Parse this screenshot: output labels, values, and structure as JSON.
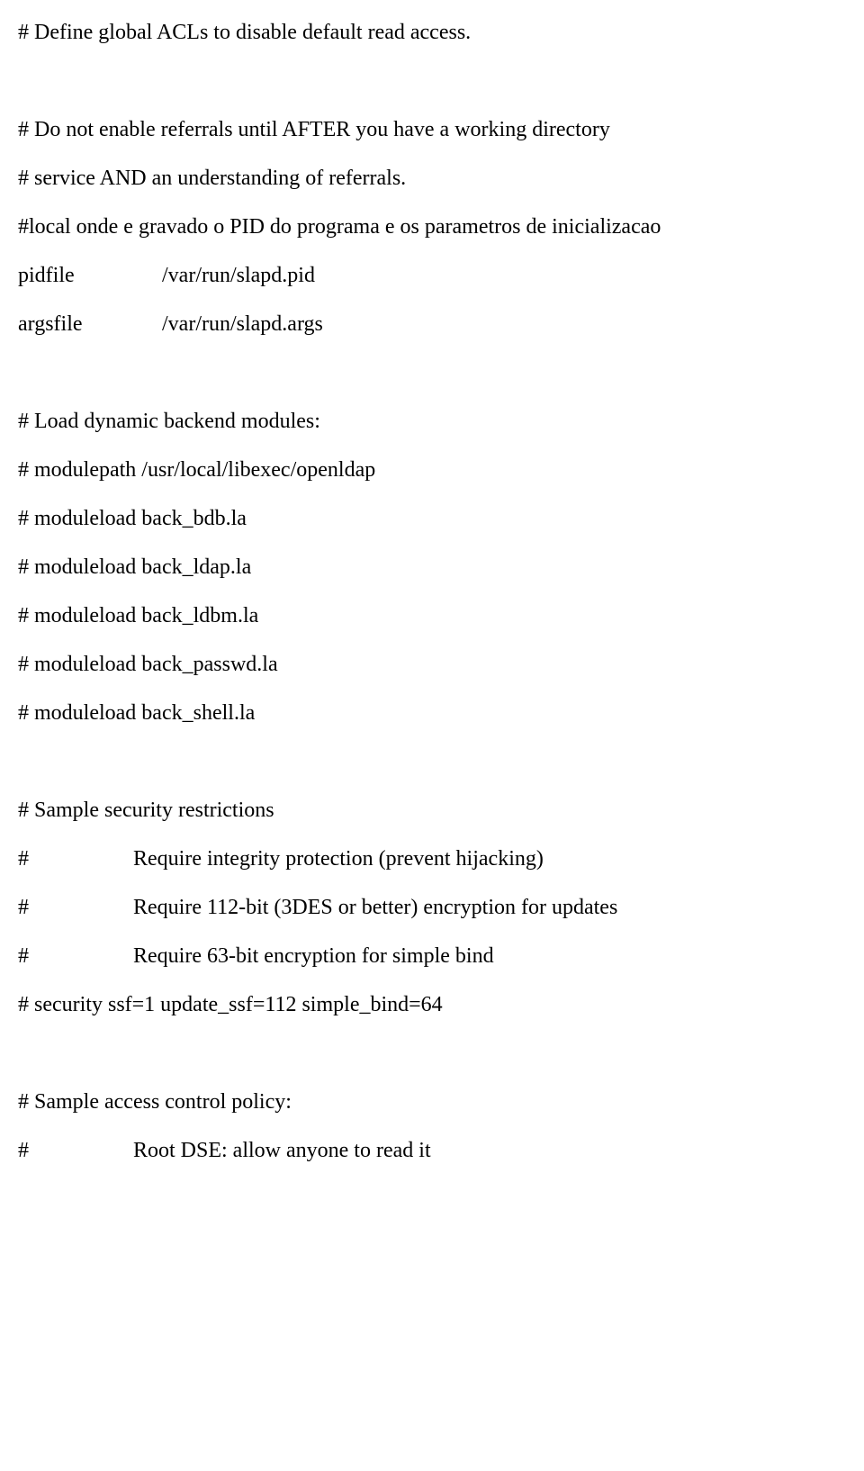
{
  "lines": {
    "l1": "# Define global ACLs to disable default read access.",
    "l2": "# Do not enable referrals until AFTER you have a working directory",
    "l3": "# service AND an understanding of referrals.",
    "l4": "#local onde e gravado o PID do programa e os parametros de inicializacao",
    "l5": "# Load dynamic backend modules:",
    "l6": "# modulepath  /usr/local/libexec/openldap",
    "l7": "# moduleload  back_bdb.la",
    "l8": "# moduleload  back_ldap.la",
    "l9": "# moduleload  back_ldbm.la",
    "l10": "# moduleload  back_passwd.la",
    "l11": "# moduleload  back_shell.la",
    "l12": "# Sample security restrictions",
    "l13": "Require integrity protection (prevent hijacking)",
    "l14": "Require 112-bit (3DES or better) encryption for updates",
    "l15": "Require 63-bit encryption for simple bind",
    "l16": "# security ssf=1 update_ssf=112 simple_bind=64",
    "l17": "# Sample access control policy:",
    "l18": "Root DSE: allow anyone to read it"
  },
  "kv": {
    "pidfile_k": "pidfile",
    "pidfile_v": "/var/run/slapd.pid",
    "argsfile_k": "argsfile",
    "argsfile_v": "/var/run/slapd.args"
  },
  "hash": "#"
}
